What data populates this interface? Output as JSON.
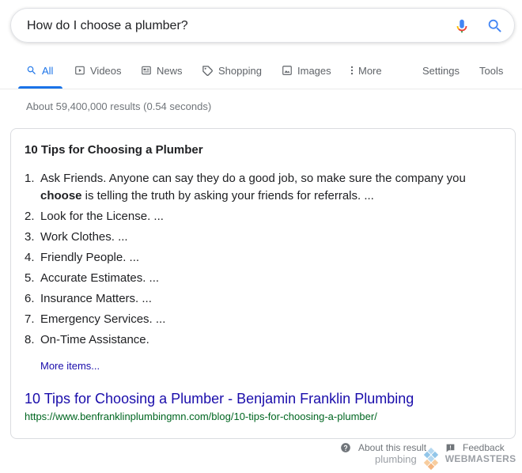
{
  "search": {
    "query": "How do I choose a plumber?",
    "mic_icon": "mic-icon",
    "search_icon": "search-icon"
  },
  "tabs": [
    {
      "label": "All",
      "icon": "search-icon",
      "active": true
    },
    {
      "label": "Videos",
      "icon": "play-icon"
    },
    {
      "label": "News",
      "icon": "newspaper-icon"
    },
    {
      "label": "Shopping",
      "icon": "tag-icon"
    },
    {
      "label": "Images",
      "icon": "image-icon"
    },
    {
      "label": "More",
      "icon": "more-vert-icon"
    }
  ],
  "tools": {
    "settings": "Settings",
    "tools": "Tools"
  },
  "stats": "About 59,400,000 results (0.54 seconds)",
  "snippet": {
    "title": "10 Tips for Choosing a Plumber",
    "first_item": {
      "num": "1.",
      "before": "Ask Friends. Anyone can say they do a good job, so make sure the company you ",
      "bold": "choose",
      "after": " is telling the truth by asking your friends for referrals. ..."
    },
    "items": [
      {
        "num": "2.",
        "text": "Look for the License. ..."
      },
      {
        "num": "3.",
        "text": "Work Clothes. ..."
      },
      {
        "num": "4.",
        "text": "Friendly People. ..."
      },
      {
        "num": "5.",
        "text": "Accurate Estimates. ..."
      },
      {
        "num": "6.",
        "text": "Insurance Matters. ..."
      },
      {
        "num": "7.",
        "text": "Emergency Services. ..."
      },
      {
        "num": "8.",
        "text": "On-Time Assistance."
      }
    ],
    "more_items": "More items...",
    "result_title": "10 Tips for Choosing a Plumber - Benjamin Franklin Plumbing",
    "result_url": "https://www.benfranklinplumbingmn.com/blog/10-tips-for-choosing-a-plumber/"
  },
  "footer": {
    "about": "About this result",
    "feedback": "Feedback"
  },
  "watermark": {
    "plumbing": "plumbing",
    "webmasters": "WEBMASTERS"
  },
  "colors": {
    "link": "#1a0dab",
    "url_green": "#006621",
    "active_tab": "#1a73e8",
    "muted": "#70757a"
  }
}
